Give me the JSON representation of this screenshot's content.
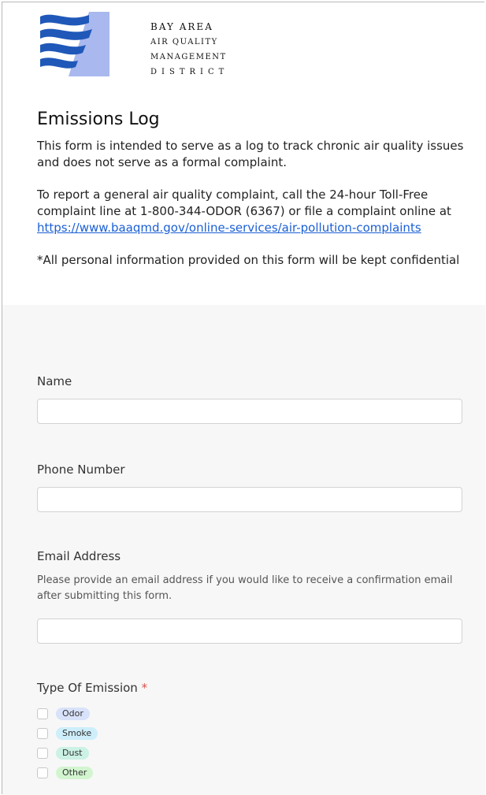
{
  "colors": {
    "odor_pill": "#d8e2fa",
    "smoke_pill": "#cdeefa",
    "dust_pill": "#cbf2e4",
    "other_pill": "#d2f5cf",
    "link": "#1a5fd6",
    "required": "#d9534f"
  },
  "logo": {
    "line1": "BAY AREA",
    "line2": "AIR QUALITY",
    "line3": "MANAGEMENT",
    "line4": "DISTRICT"
  },
  "form_title": "Emissions Log",
  "intro": {
    "p1": "This form is intended to serve as a log to track chronic air quality issues and does not serve as a formal complaint.",
    "p2_text": "To report a general air quality complaint, call the 24-hour Toll-Free complaint line at 1-800-344-ODOR (6367) or file a complaint online at ",
    "p2_link": "https://www.baaqmd.gov/online-services/air-pollution-complaints",
    "p3": "*All personal information provided on this form will be kept confidential"
  },
  "fields": {
    "name_label": "Name",
    "phone_label": "Phone Number",
    "email_label": "Email Address",
    "email_help": "Please provide an email address if you would like to receive a confirmation email after submitting this form.",
    "type_label": "Type Of Emission",
    "required_mark": "*"
  },
  "emission_types": [
    "Odor",
    "Smoke",
    "Dust",
    "Other"
  ]
}
